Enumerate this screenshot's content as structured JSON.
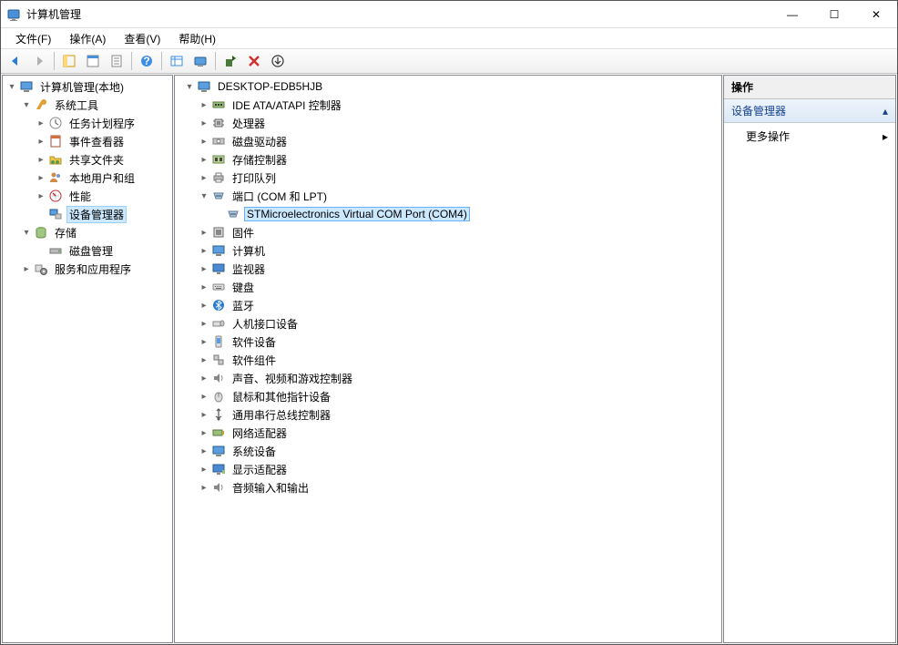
{
  "window": {
    "title": "计算机管理",
    "minimize": "—",
    "maximize": "☐",
    "close": "✕"
  },
  "menu": {
    "file": "文件(F)",
    "action": "操作(A)",
    "view": "查看(V)",
    "help": "帮助(H)"
  },
  "left_tree": {
    "root": "计算机管理(本地)",
    "system_tools": "系统工具",
    "task_scheduler": "任务计划程序",
    "event_viewer": "事件查看器",
    "shared_folders": "共享文件夹",
    "local_users": "本地用户和组",
    "performance": "性能",
    "device_manager": "设备管理器",
    "storage": "存储",
    "disk_management": "磁盘管理",
    "services_apps": "服务和应用程序"
  },
  "center_tree": {
    "root": "DESKTOP-EDB5HJB",
    "ide": "IDE ATA/ATAPI 控制器",
    "cpu": "处理器",
    "disk_drives": "磁盘驱动器",
    "storage_controllers": "存储控制器",
    "print_queues": "打印队列",
    "ports": "端口 (COM 和 LPT)",
    "com_port_item": "STMicroelectronics Virtual COM Port (COM4)",
    "firmware": "固件",
    "computer": "计算机",
    "monitors": "监视器",
    "keyboards": "键盘",
    "bluetooth": "蓝牙",
    "hid": "人机接口设备",
    "soft_devices": "软件设备",
    "soft_components": "软件组件",
    "sound": "声音、视频和游戏控制器",
    "mice": "鼠标和其他指针设备",
    "usb": "通用串行总线控制器",
    "network": "网络适配器",
    "system_devices": "系统设备",
    "display": "显示适配器",
    "audio_io": "音频输入和输出"
  },
  "actions": {
    "header": "操作",
    "section": "设备管理器",
    "more": "更多操作"
  }
}
